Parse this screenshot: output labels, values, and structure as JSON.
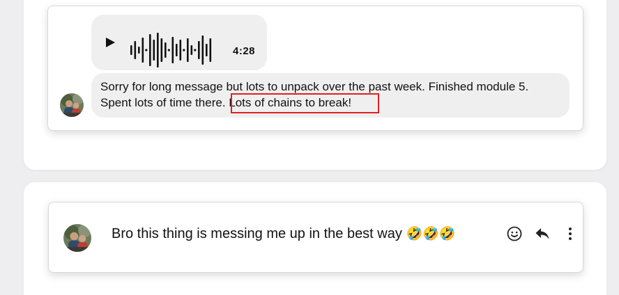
{
  "thread": {
    "voice_message": {
      "play_icon": "play-icon",
      "duration": "4:28"
    },
    "text_message": {
      "line1": "Sorry for long message but lots to unpack over the past week. Finished module 5.",
      "line2_prefix": "Spent lots of time there.",
      "line2_highlight": " Lots of chains to break!",
      "highlight_color": "#e02020"
    }
  },
  "reply": {
    "text": "Bro this thing is messing me up in the best way",
    "emojis": "🤣🤣🤣",
    "actions": [
      {
        "name": "react",
        "icon": "smiley-icon"
      },
      {
        "name": "reply",
        "icon": "reply-arrow-icon"
      },
      {
        "name": "more",
        "icon": "more-vertical-icon"
      }
    ]
  },
  "colors": {
    "background": "#eeeef0",
    "bubble": "#efefef",
    "card_border": "#d8d8d8"
  }
}
